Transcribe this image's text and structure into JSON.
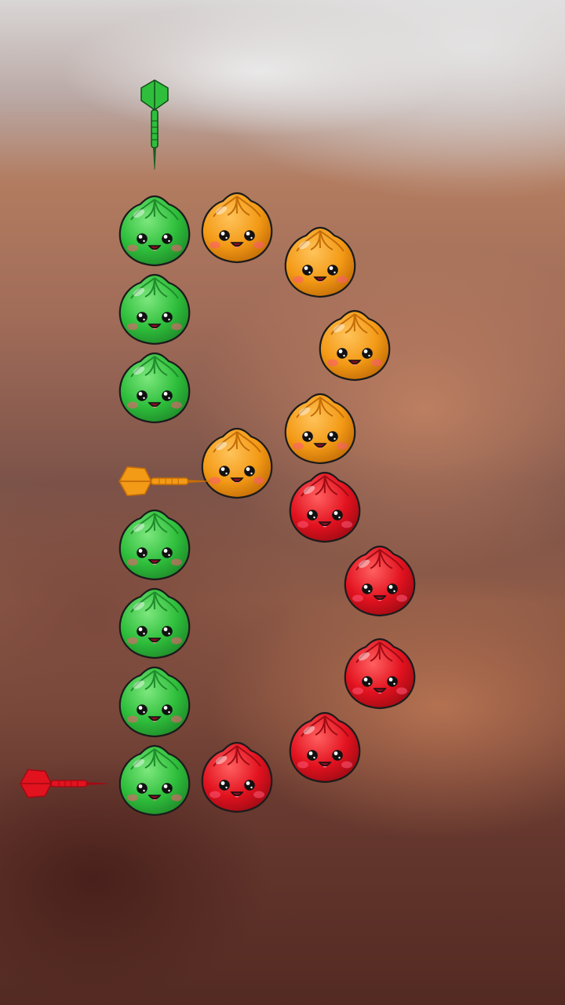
{
  "colors": {
    "green": {
      "light": "#7de77e",
      "base": "#2fbf3c",
      "dark": "#1f8c2a"
    },
    "orange": {
      "light": "#ffc35a",
      "base": "#f39a16",
      "dark": "#c46d07"
    },
    "red": {
      "light": "#ff6060",
      "base": "#e2121f",
      "dark": "#a10b14"
    }
  },
  "icons": {
    "bun": "smiling-dumpling-icon",
    "dart": "dart-icon"
  },
  "game_board": {
    "buns": [
      {
        "color": "green"
      },
      {
        "color": "green"
      },
      {
        "color": "green"
      },
      {
        "color": "green"
      },
      {
        "color": "green"
      },
      {
        "color": "green"
      },
      {
        "color": "green"
      },
      {
        "color": "orange"
      },
      {
        "color": "orange"
      },
      {
        "color": "orange"
      },
      {
        "color": "orange"
      },
      {
        "color": "orange"
      },
      {
        "color": "red"
      },
      {
        "color": "red"
      },
      {
        "color": "red"
      },
      {
        "color": "red"
      },
      {
        "color": "red"
      }
    ],
    "darts": [
      {
        "color": "green",
        "direction": "down"
      },
      {
        "color": "orange",
        "direction": "right"
      },
      {
        "color": "red",
        "direction": "right"
      }
    ]
  }
}
